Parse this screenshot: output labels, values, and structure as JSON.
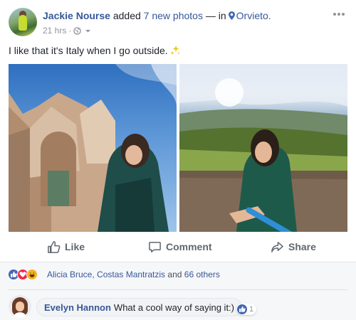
{
  "post": {
    "author": "Jackie Nourse",
    "action_prefix": "added",
    "action_photos": "7 new photos",
    "action_suffix": "— in",
    "location": "Orvieto.",
    "time": "21 hrs",
    "meta_separator": "·",
    "text": "I like that it's Italy when I go outside.",
    "icons": {
      "avatar": "profile-photo",
      "location": "map-pin-icon",
      "privacy": "globe-icon",
      "audience_menu": "chevron-down-icon",
      "more": "more-options-icon",
      "emoji": "sparkles-icon"
    }
  },
  "photos": [
    {
      "description_icon": "cathedral-selfie-photo"
    },
    {
      "description_icon": "landscape-selfie-photo"
    }
  ],
  "actions": {
    "like_label": "Like",
    "comment_label": "Comment",
    "share_label": "Share"
  },
  "reactions": {
    "types": [
      "like",
      "love",
      "haha"
    ],
    "names": "Alicia Bruce, Costas Mantratzis",
    "conjunction": "and",
    "others": "66 others"
  },
  "comment": {
    "author": "Evelyn Hannon",
    "text": "What a cool way of saying it:)",
    "like_count": "1"
  },
  "colors": {
    "link_blue": "#365899",
    "facebook_blue": "#4267b2",
    "love_red": "#f0284a",
    "haha_yellow": "#f7b125",
    "muted_text": "#90949c",
    "action_text": "#606770"
  }
}
